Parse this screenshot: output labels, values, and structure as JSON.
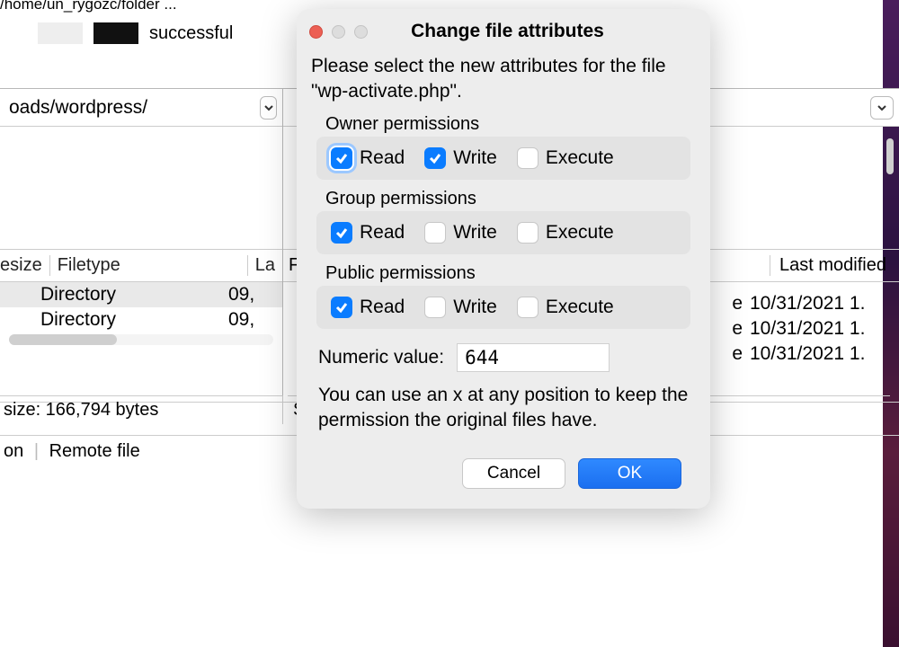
{
  "bg": {
    "top_path": "/home/un_rygozc/folder ...",
    "legend_text": "successful",
    "left_path": "oads/wordpress/",
    "left_cols": {
      "size": "esize",
      "filetype": "Filetype",
      "last": "La"
    },
    "left_rows": [
      {
        "ft": "Directory",
        "date": "09,"
      },
      {
        "ft": "Directory",
        "date": "09,"
      }
    ],
    "left_footer": "size: 166,794 bytes",
    "right_header": {
      "f": "F",
      "last": "Last modified"
    },
    "right_rows": [
      {
        "e": "e",
        "date": "10/31/2021 1."
      },
      {
        "e": "e",
        "date": "10/31/2021 1."
      },
      {
        "e": "e",
        "date": "10/31/2021 1."
      }
    ],
    "right_footer_s": "S",
    "status": {
      "on": "on",
      "remote": "Remote file"
    }
  },
  "dialog": {
    "title": "Change file attributes",
    "intro": "Please select the new attributes for the file \"wp-activate.php\".",
    "groups": {
      "owner": {
        "label": "Owner permissions",
        "read": true,
        "write": true,
        "execute": false
      },
      "group": {
        "label": "Group permissions",
        "read": true,
        "write": false,
        "execute": false
      },
      "public": {
        "label": "Public permissions",
        "read": true,
        "write": false,
        "execute": false
      }
    },
    "perm_labels": {
      "read": "Read",
      "write": "Write",
      "execute": "Execute"
    },
    "numeric_label": "Numeric value:",
    "numeric_value": "644",
    "hint": "You can use an x at any position to keep the permission the original files have.",
    "buttons": {
      "cancel": "Cancel",
      "ok": "OK"
    }
  }
}
